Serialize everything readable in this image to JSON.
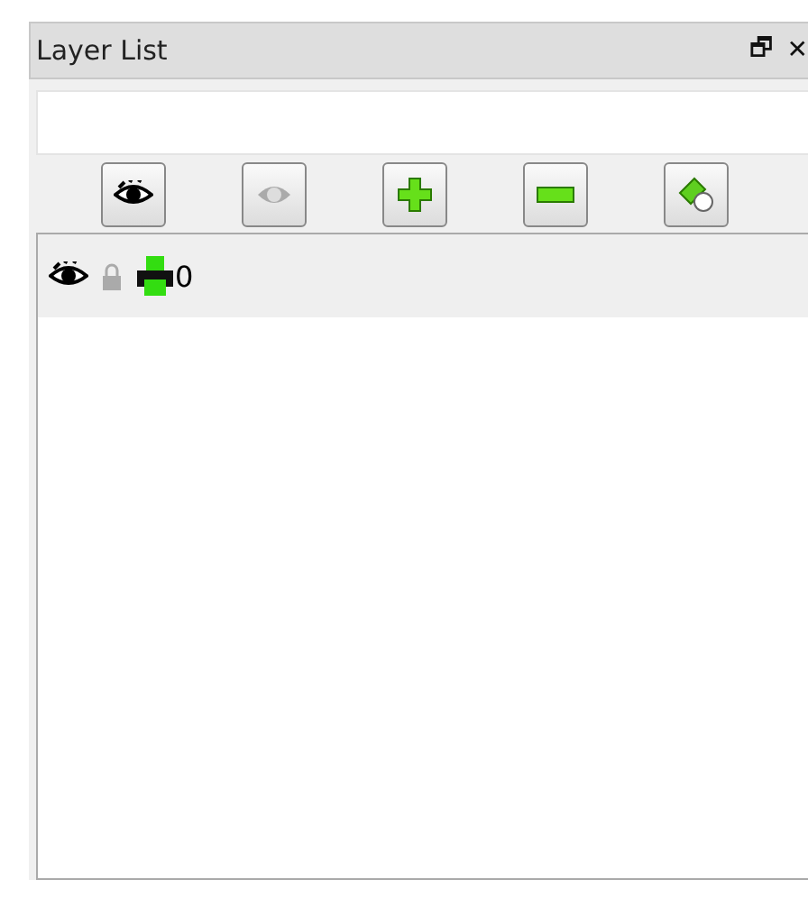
{
  "panel": {
    "title": "Layer List",
    "controls": [
      "🗗",
      "✕"
    ]
  },
  "toolbar": [
    {
      "kind": "show"
    },
    {
      "kind": "hide"
    },
    {
      "kind": "add"
    },
    {
      "kind": "remove"
    },
    {
      "kind": "edit"
    }
  ],
  "layers": [
    {
      "name": "0",
      "visible": true,
      "locked": false,
      "selected": true
    }
  ]
}
